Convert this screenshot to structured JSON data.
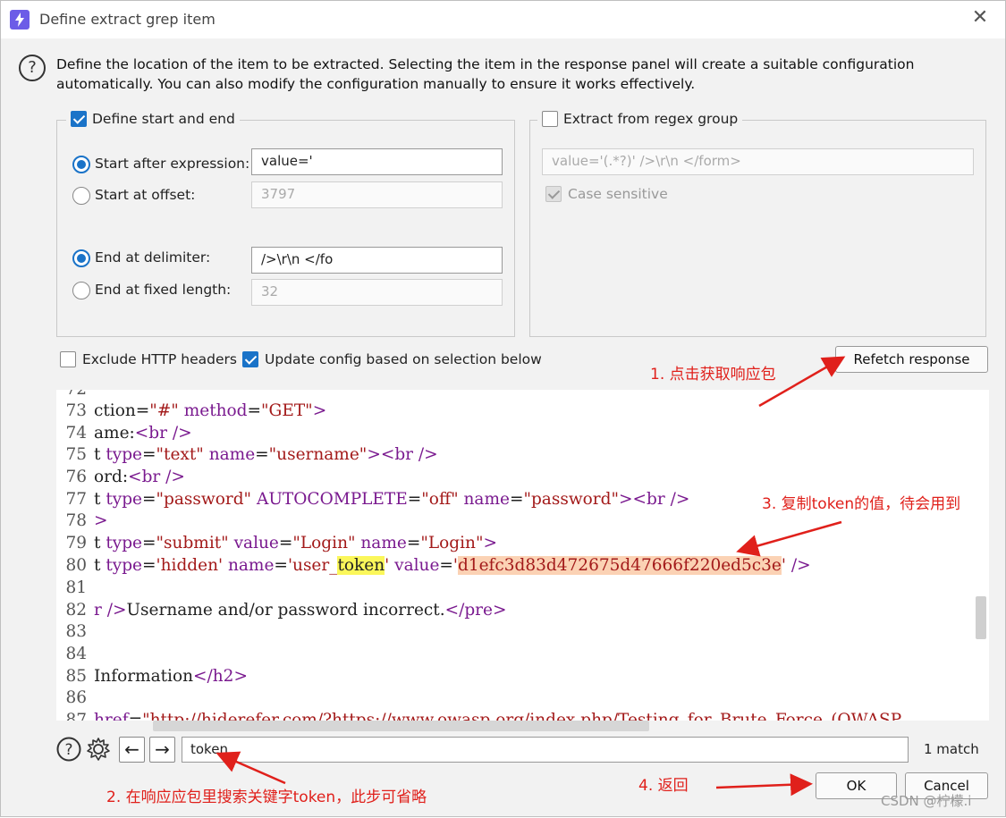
{
  "window": {
    "title": "Define extract grep item",
    "close_glyph": "✕",
    "app_icon": "burp-lightning-icon"
  },
  "intro": {
    "text": "Define the location of the item to be extracted. Selecting the item in the response panel will create a suitable configuration automatically. You can also modify the configuration manually to ensure it works effectively."
  },
  "start_end_group": {
    "label": "Define start and end",
    "checked": true,
    "start_after_label": "Start after expression:",
    "start_after_value": "value='",
    "start_offset_label": "Start at offset:",
    "start_offset_value": "3797",
    "end_delimiter_label": "End at delimiter:",
    "end_delimiter_value": "/>\\r\\n                                </fo",
    "end_fixed_label": "End at fixed length:",
    "end_fixed_value": "32"
  },
  "regex_group": {
    "label": "Extract from regex group",
    "checked": false,
    "regex_value": "value='(.*?)' />\\r\\n                      </form>",
    "case_sensitive_label": "Case sensitive",
    "case_sensitive_checked": true
  },
  "options": {
    "exclude_headers_label": "Exclude HTTP headers",
    "exclude_headers_checked": false,
    "update_config_label": "Update config based on selection below",
    "update_config_checked": true,
    "refetch_label": "Refetch response"
  },
  "code_lines": [
    {
      "n": "72",
      "html": ""
    },
    {
      "n": "73",
      "parts": [
        [
          "t",
          "ction="
        ],
        [
          "s",
          "\"#\""
        ],
        [
          "t",
          " "
        ],
        [
          "a",
          "method"
        ],
        [
          "t",
          "="
        ],
        [
          "s",
          "\"GET\""
        ],
        [
          "a",
          ">"
        ]
      ]
    },
    {
      "n": "74",
      "parts": [
        [
          "t",
          "ame:"
        ],
        [
          "a",
          "<br />"
        ]
      ]
    },
    {
      "n": "75",
      "parts": [
        [
          "t",
          "t "
        ],
        [
          "a",
          "type"
        ],
        [
          "t",
          "="
        ],
        [
          "s",
          "\"text\""
        ],
        [
          "t",
          " "
        ],
        [
          "a",
          "name"
        ],
        [
          "t",
          "="
        ],
        [
          "s",
          "\"username\""
        ],
        [
          "a",
          ">"
        ],
        [
          "a",
          "<br />"
        ]
      ]
    },
    {
      "n": "76",
      "parts": [
        [
          "t",
          "ord:"
        ],
        [
          "a",
          "<br />"
        ]
      ]
    },
    {
      "n": "77",
      "parts": [
        [
          "t",
          "t "
        ],
        [
          "a",
          "type"
        ],
        [
          "t",
          "="
        ],
        [
          "s",
          "\"password\""
        ],
        [
          "t",
          " "
        ],
        [
          "a",
          "AUTOCOMPLETE"
        ],
        [
          "t",
          "="
        ],
        [
          "s",
          "\"off\""
        ],
        [
          "t",
          " "
        ],
        [
          "a",
          "name"
        ],
        [
          "t",
          "="
        ],
        [
          "s",
          "\"password\""
        ],
        [
          "a",
          ">"
        ],
        [
          "a",
          "<br />"
        ]
      ]
    },
    {
      "n": "78",
      "parts": [
        [
          "a",
          ">"
        ]
      ]
    },
    {
      "n": "79",
      "parts": [
        [
          "t",
          "t "
        ],
        [
          "a",
          "type"
        ],
        [
          "t",
          "="
        ],
        [
          "s",
          "\"submit\""
        ],
        [
          "t",
          " "
        ],
        [
          "a",
          "value"
        ],
        [
          "t",
          "="
        ],
        [
          "s",
          "\"Login\""
        ],
        [
          "t",
          " "
        ],
        [
          "a",
          "name"
        ],
        [
          "t",
          "="
        ],
        [
          "s",
          "\"Login\""
        ],
        [
          "a",
          ">"
        ]
      ]
    },
    {
      "n": "80",
      "parts": [
        [
          "t",
          "t "
        ],
        [
          "a",
          "type"
        ],
        [
          "t",
          "="
        ],
        [
          "s",
          "'hidden'"
        ],
        [
          "t",
          " "
        ],
        [
          "a",
          "name"
        ],
        [
          "t",
          "="
        ],
        [
          "s",
          "'user_"
        ],
        [
          "y",
          "token"
        ],
        [
          "s",
          "'"
        ],
        [
          "t",
          " "
        ],
        [
          "a",
          "value"
        ],
        [
          "t",
          "="
        ],
        [
          "s",
          "'"
        ],
        [
          "o",
          "d1efc3d83d472675d47666f220ed5c3e"
        ],
        [
          "s",
          "'"
        ],
        [
          "t",
          " "
        ],
        [
          "a",
          "/>"
        ]
      ]
    },
    {
      "n": "81",
      "parts": []
    },
    {
      "n": "82",
      "parts": [
        [
          "a",
          "r />"
        ],
        [
          "t",
          "Username and/or password incorrect."
        ],
        [
          "a",
          "</pre>"
        ]
      ]
    },
    {
      "n": "83",
      "parts": []
    },
    {
      "n": "84",
      "parts": []
    },
    {
      "n": "85",
      "parts": [
        [
          "t",
          "Information"
        ],
        [
          "a",
          "</h2>"
        ]
      ]
    },
    {
      "n": "86",
      "parts": []
    },
    {
      "n": "87",
      "parts": [
        [
          "a",
          "href"
        ],
        [
          "t",
          "="
        ],
        [
          "s",
          "\"http://hiderefer.com/?https://www.owasp.org/index.php/Testing_for_Brute_Force_(OWASP"
        ]
      ]
    }
  ],
  "search": {
    "value": "token",
    "match_count": "1 match"
  },
  "buttons": {
    "ok": "OK",
    "cancel": "Cancel"
  },
  "annotations": {
    "a1": "1.  点击获取响应包",
    "a2": "2. 在响应应包里搜索关键字token，此步可省略",
    "a3": "3.  复制token的值，待会用到",
    "a4": "4. 返回"
  },
  "watermark": "CSDN @柠檬.i",
  "colors": {
    "accent": "#1a73c8",
    "annotation_red": "#e0201b",
    "highlight_yellow": "#fbf75a",
    "highlight_orange": "#fbd2b4"
  }
}
